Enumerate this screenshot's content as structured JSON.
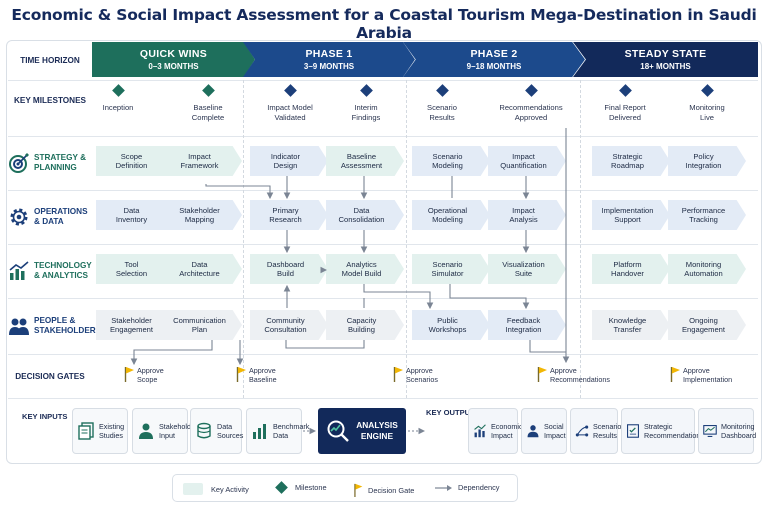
{
  "title": "Economic & Social Impact Assessment for a Coastal Tourism Mega-Destination in Saudi Arabia",
  "colors": {
    "teal": "#1e6f5c",
    "navy": "#12295a",
    "blue": "#1c4a8c",
    "activity_fill": "#e3f1ee",
    "gate_yellow": "#f2b705"
  },
  "rows": {
    "time_horizon": "TIME HORIZON",
    "key_milestones": "KEY MILESTONES",
    "strategy": {
      "label": "STRATEGY & PLANNING",
      "icon": "strategy-target-icon"
    },
    "operations": {
      "label": "OPERATIONS & DATA",
      "icon": "gear-icon"
    },
    "technology": {
      "label": "TECHNOLOGY & ANALYTICS",
      "icon": "bar-chart-icon"
    },
    "people": {
      "label": "PEOPLE & STAKEHOLDERS",
      "icon": "people-icon"
    },
    "decision_gates": "DECISION GATES"
  },
  "phases": [
    {
      "name": "QUICK WINS",
      "range": "0–3 MONTHS"
    },
    {
      "name": "PHASE 1",
      "range": "3–9 MONTHS"
    },
    {
      "name": "PHASE 2",
      "range": "9–18 MONTHS"
    },
    {
      "name": "STEADY STATE",
      "range": "18+ MONTHS"
    }
  ],
  "milestones": [
    {
      "line1": "Inception",
      "line2": ""
    },
    {
      "line1": "Baseline",
      "line2": "Complete"
    },
    {
      "line1": "Impact Model",
      "line2": "Validated"
    },
    {
      "line1": "Interim",
      "line2": "Findings"
    },
    {
      "line1": "Scenario",
      "line2": "Results"
    },
    {
      "line1": "Recommendations",
      "line2": "Approved"
    },
    {
      "line1": "Final Report",
      "line2": "Delivered"
    },
    {
      "line1": "Monitoring",
      "line2": "Live"
    }
  ],
  "activities": {
    "strategy": [
      {
        "l1": "Scope",
        "l2": "Definition"
      },
      {
        "l1": "Impact",
        "l2": "Framework"
      },
      {
        "l1": "Indicator",
        "l2": "Design"
      },
      {
        "l1": "Baseline",
        "l2": "Assessment"
      },
      {
        "l1": "Scenario",
        "l2": "Modeling"
      },
      {
        "l1": "Impact",
        "l2": "Quantification"
      },
      {
        "l1": "Strategic",
        "l2": "Roadmap"
      },
      {
        "l1": "Policy",
        "l2": "Integration"
      }
    ],
    "operations": [
      {
        "l1": "Data",
        "l2": "Inventory"
      },
      {
        "l1": "Stakeholder",
        "l2": "Mapping"
      },
      {
        "l1": "Primary",
        "l2": "Research"
      },
      {
        "l1": "Data",
        "l2": "Consolidation"
      },
      {
        "l1": "Operational",
        "l2": "Modeling"
      },
      {
        "l1": "Impact",
        "l2": "Analysis"
      },
      {
        "l1": "Implementation",
        "l2": "Support"
      },
      {
        "l1": "Performance",
        "l2": "Tracking"
      }
    ],
    "technology": [
      {
        "l1": "Tool",
        "l2": "Selection"
      },
      {
        "l1": "Data",
        "l2": "Architecture"
      },
      {
        "l1": "Dashboard",
        "l2": "Build"
      },
      {
        "l1": "Analytics",
        "l2": "Model Build"
      },
      {
        "l1": "Scenario",
        "l2": "Simulator"
      },
      {
        "l1": "Visualization",
        "l2": "Suite"
      },
      {
        "l1": "Platform",
        "l2": "Handover"
      },
      {
        "l1": "Monitoring",
        "l2": "Automation"
      }
    ],
    "people": [
      {
        "l1": "Stakeholder",
        "l2": "Engagement"
      },
      {
        "l1": "Communication",
        "l2": "Plan"
      },
      {
        "l1": "Community",
        "l2": "Consultation"
      },
      {
        "l1": "Capacity",
        "l2": "Building"
      },
      {
        "l1": "Public",
        "l2": "Workshops"
      },
      {
        "l1": "Feedback",
        "l2": "Integration"
      },
      {
        "l1": "Knowledge",
        "l2": "Transfer"
      },
      {
        "l1": "Ongoing",
        "l2": "Engagement"
      }
    ]
  },
  "gates": [
    {
      "l1": "Approve",
      "l2": "Scope"
    },
    {
      "l1": "Approve",
      "l2": "Baseline"
    },
    {
      "l1": "Approve",
      "l2": "Scenarios"
    },
    {
      "l1": "Approve",
      "l2": "Recommendations"
    },
    {
      "l1": "Approve",
      "l2": "Implementation"
    }
  ],
  "key_inputs_label": "KEY INPUTS",
  "key_outputs_label": "KEY OUTPUTS",
  "inputs": [
    {
      "l1": "Existing",
      "l2": "Studies",
      "icon": "documents-icon"
    },
    {
      "l1": "Stakeholder",
      "l2": "Input",
      "icon": "person-icon"
    },
    {
      "l1": "Data",
      "l2": "Sources",
      "icon": "database-icon"
    },
    {
      "l1": "Benchmark",
      "l2": "Data",
      "icon": "benchmark-chart-icon"
    }
  ],
  "engine": {
    "l1": "ANALYSIS",
    "l2": "ENGINE",
    "icon": "magnifier-chart-icon"
  },
  "outputs": [
    {
      "l1": "Economic",
      "l2": "Impact",
      "icon": "economic-chart-icon"
    },
    {
      "l1": "Social",
      "l2": "Impact",
      "icon": "social-people-icon"
    },
    {
      "l1": "Scenario",
      "l2": "Results",
      "icon": "scenario-branch-icon"
    },
    {
      "l1": "Strategic",
      "l2": "Recommendations",
      "icon": "checklist-icon"
    },
    {
      "l1": "Monitoring",
      "l2": "Dashboard",
      "icon": "monitor-icon"
    }
  ],
  "legend": {
    "activity": "Key Activity",
    "milestone": "Milestone",
    "gate": "Decision Gate",
    "dependency": "Dependency"
  }
}
